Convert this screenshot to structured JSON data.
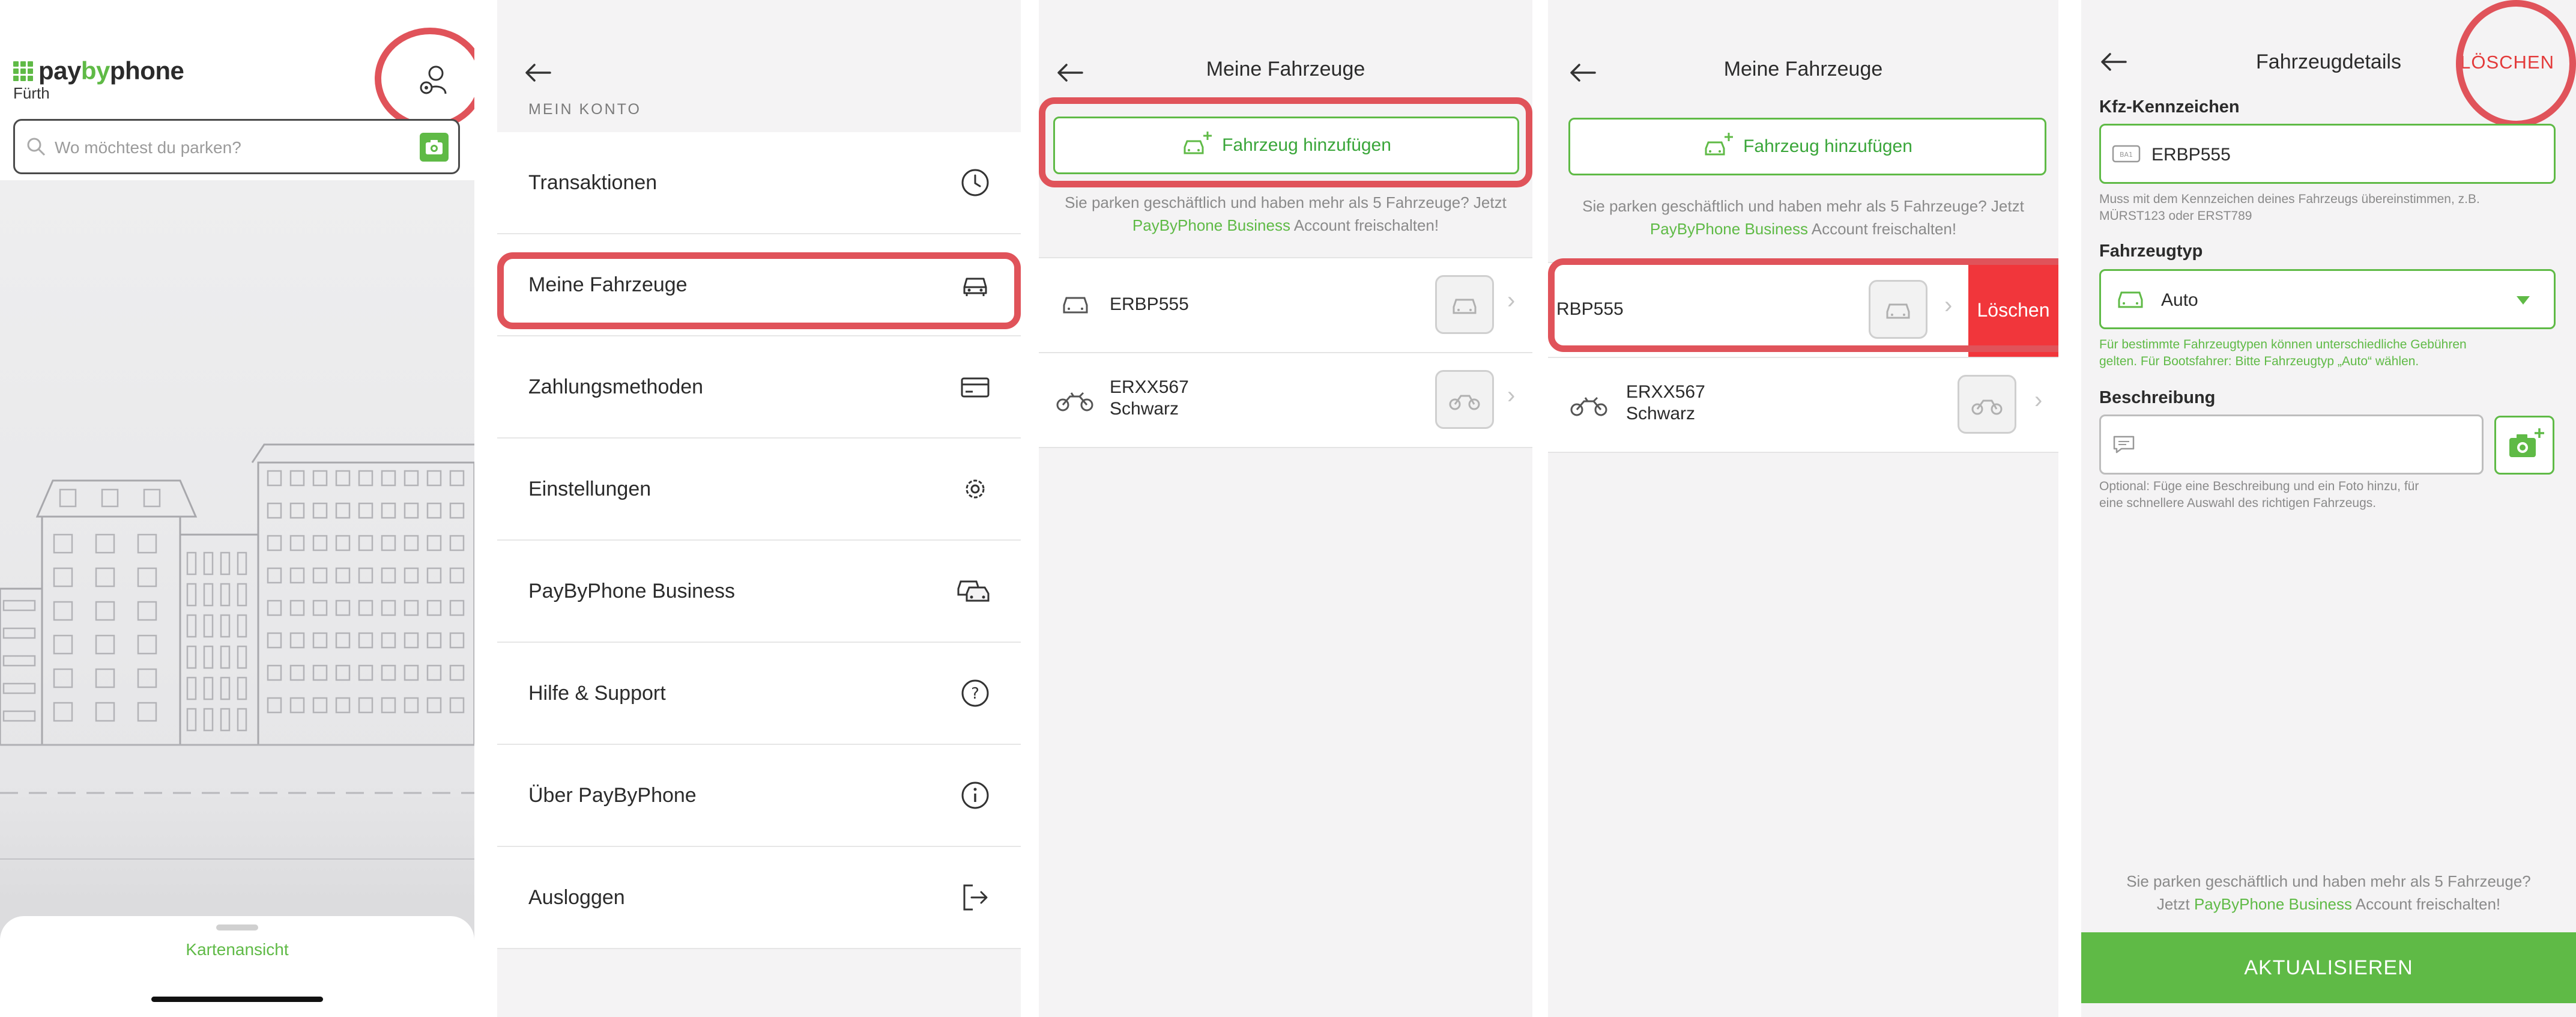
{
  "panel1": {
    "logo": {
      "pay": "pay",
      "by": "by",
      "phone": "phone"
    },
    "city": "Fürth",
    "search_placeholder": "Wo möchtest du parken?",
    "kartenansicht": "Kartenansicht",
    "profile_icon": "profile-settings-icon",
    "camera_icon": "camera-icon"
  },
  "panel2": {
    "section_label": "MEIN KONTO",
    "items": [
      {
        "label": "Transaktionen",
        "icon": "clock-icon"
      },
      {
        "label": "Meine Fahrzeuge",
        "icon": "car-icon"
      },
      {
        "label": "Zahlungsmethoden",
        "icon": "credit-card-icon"
      },
      {
        "label": "Einstellungen",
        "icon": "gear-icon"
      },
      {
        "label": "PayByPhone Business",
        "icon": "cars-icon"
      },
      {
        "label": "Hilfe & Support",
        "icon": "question-icon"
      },
      {
        "label": "Über PayByPhone",
        "icon": "info-icon"
      },
      {
        "label": "Ausloggen",
        "icon": "logout-icon"
      }
    ]
  },
  "panel3": {
    "title": "Meine Fahrzeuge",
    "add_button": "Fahrzeug hinzufügen",
    "hint_line1": "Sie parken geschäftlich und haben mehr als 5 Fahrzeuge? Jetzt",
    "hint_link": "PayByPhone Business",
    "hint_rest": " Account freischalten!",
    "vehicles": [
      {
        "plate": "ERBP555",
        "sub": "",
        "type": "car"
      },
      {
        "plate": "ERXX567",
        "sub": "Schwarz",
        "type": "motorcycle"
      }
    ]
  },
  "panel4": {
    "title": "Meine Fahrzeuge",
    "add_button": "Fahrzeug hinzufügen",
    "hint_line1": "Sie parken geschäftlich und haben mehr als 5 Fahrzeuge? Jetzt",
    "hint_link": "PayByPhone Business",
    "hint_rest": " Account freischalten!",
    "swiped_plate": "RBP555",
    "delete_label": "Löschen",
    "vehicle2_plate": "ERXX567",
    "vehicle2_sub": "Schwarz"
  },
  "panel5": {
    "title": "Fahrzeugdetails",
    "delete": "LÖSCHEN",
    "plate_label": "Kfz-Kennzeichen",
    "plate_value": "ERBP555",
    "plate_help_1": "Muss mit dem Kennzeichen deines Fahrzeugs übereinstimmen, z.B.",
    "plate_help_2": "MÜRST123 oder ERST789",
    "type_label": "Fahrzeugtyp",
    "type_value": "Auto",
    "type_help_1": "Für bestimmte Fahrzeugtypen können unterschiedliche Gebühren",
    "type_help_2": "gelten. Für Bootsfahrer: Bitte Fahrzeugtyp „Auto“ wählen.",
    "desc_label": "Beschreibung",
    "desc_help_1": "Optional: Füge eine Beschreibung und ein Foto hinzu, für",
    "desc_help_2": "eine schnellere Auswahl des richtigen Fahrzeugs.",
    "bottom_hint_1": "Sie parken geschäftlich und haben mehr als 5 Fahrzeuge?",
    "bottom_hint_2a": "Jetzt ",
    "bottom_hint_link": "PayByPhone Business",
    "bottom_hint_2b": " Account freischalten!",
    "update_button": "AKTUALISIEREN"
  },
  "colors": {
    "accent": "#5fba46",
    "highlight": "#e0535a",
    "danger": "#f1363b"
  }
}
